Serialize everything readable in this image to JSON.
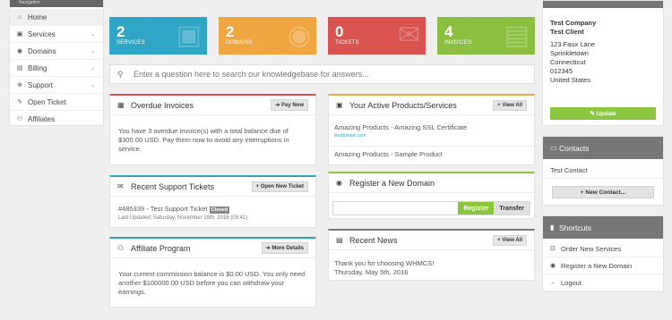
{
  "top_strip": {
    "left_text": "Navigation"
  },
  "nav": [
    {
      "label": "Home",
      "icon": "home-icon",
      "glyph": "⌂",
      "chevron": false,
      "active": true
    },
    {
      "label": "Services",
      "icon": "cube-icon",
      "glyph": "▣",
      "chevron": true,
      "active": false
    },
    {
      "label": "Domains",
      "icon": "globe-icon",
      "glyph": "◉",
      "chevron": true,
      "active": false
    },
    {
      "label": "Billing",
      "icon": "credit-card-icon",
      "glyph": "▤",
      "chevron": true,
      "active": false
    },
    {
      "label": "Support",
      "icon": "life-ring-icon",
      "glyph": "⊕",
      "chevron": true,
      "active": false
    },
    {
      "label": "Open Ticket",
      "icon": "ticket-icon",
      "glyph": "✎",
      "chevron": false,
      "active": false
    },
    {
      "label": "Affiliates",
      "icon": "users-icon",
      "glyph": "⚇",
      "chevron": false,
      "active": false
    }
  ],
  "tiles": [
    {
      "number": "2",
      "label": "SERVICES",
      "color": "#2fa6c5"
    },
    {
      "number": "2",
      "label": "DOMAINS",
      "color": "#efa640"
    },
    {
      "number": "0",
      "label": "TICKETS",
      "color": "#d9534f"
    },
    {
      "number": "4",
      "label": "INVOICES",
      "color": "#8cbf3f"
    }
  ],
  "search": {
    "placeholder": "Enter a question here to search our knowledgebase for answers..."
  },
  "overdue": {
    "title": "Overdue Invoices",
    "button": "Pay Now",
    "body": "You have 3 overdue invoice(s) with a total balance due of $300.00 USD. Pay them now to avoid any interruptions in service."
  },
  "tickets": {
    "title": "Recent Support Tickets",
    "button": "+ Open New Ticket",
    "item": "#485339 - Test Support Ticket",
    "status": "Closed",
    "updated": "Last Updated: Saturday, November 19th, 2016 (09:41)"
  },
  "affiliate": {
    "title": "Affiliate Program",
    "button": "More Details",
    "body": "Your current commission balance is $0.00 USD. You only need another $100000.00 USD before you can withdraw your earnings."
  },
  "products": {
    "title": "Your Active Products/Services",
    "button": "View All",
    "items": [
      {
        "name": "Amazing Products - Amazing SSL Certificate",
        "domain": "testdomain.com"
      },
      {
        "name": "Amazing Products - Sample Product",
        "domain": ""
      }
    ]
  },
  "domain": {
    "title": "Register a New Domain",
    "register": "Register",
    "transfer": "Transfer"
  },
  "news": {
    "title": "Recent News",
    "button": "View All",
    "item": "Thank you for choosing WHMCS!",
    "date": "Thursday, May 5th, 2016"
  },
  "info": {
    "company": "Test Company",
    "client": "Test Client",
    "address": [
      "123 Faux Lane",
      "Sprinkletown",
      "Connecticut",
      "012345",
      "United States"
    ],
    "update": "Update"
  },
  "contacts": {
    "title": "Contacts",
    "item": "Test Contact",
    "button": "+ New Contact..."
  },
  "shortcuts": {
    "title": "Shortcuts",
    "items": [
      {
        "label": "Order New Services",
        "icon": "cart-icon",
        "glyph": "⊡"
      },
      {
        "label": "Register a New Domain",
        "icon": "globe-icon",
        "glyph": "◉"
      },
      {
        "label": "Logout",
        "icon": "arrow-left-icon",
        "glyph": "←"
      }
    ]
  }
}
